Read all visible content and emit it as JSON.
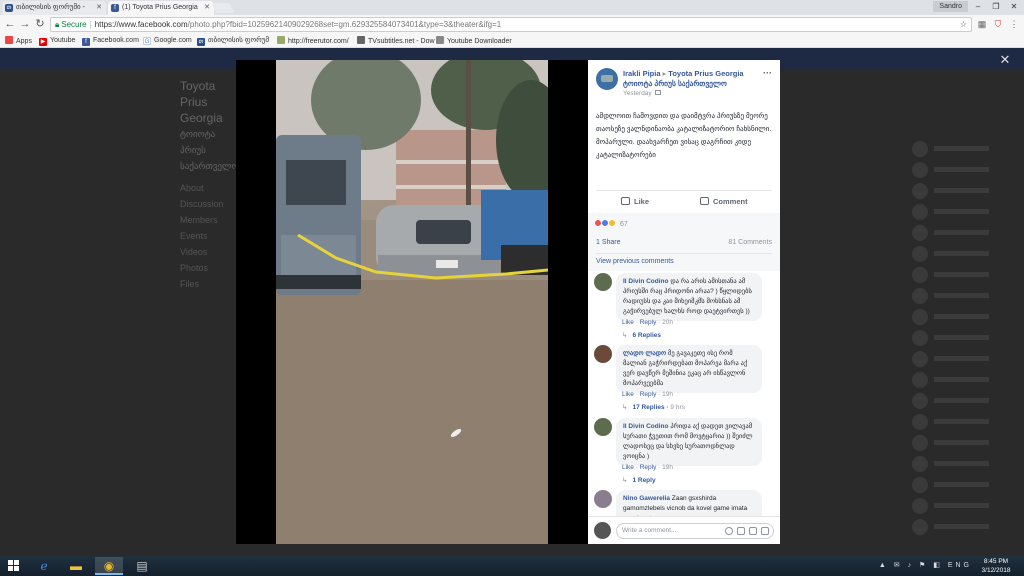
{
  "browser": {
    "tabs": [
      {
        "title": "თბილისის ფორუმი - ",
        "favicon": "forum-favicon",
        "active": false
      },
      {
        "title": "(1) Toyota Prius Georgia",
        "favicon": "facebook-favicon",
        "active": true
      }
    ],
    "user": "Sandro",
    "secure_label": "Secure",
    "url_main": "https://www.facebook.com",
    "url_rest": "/photo.php?fbid=10259621409029268set=gm.629325584073401&type=3&theater&ifg=1",
    "bookmarks": [
      {
        "label": "Apps",
        "icon": "apps-icon",
        "color": "#e44"
      },
      {
        "label": "Youtube",
        "icon": "youtube-icon",
        "color": "#e00"
      },
      {
        "label": "Facebook.com",
        "icon": "facebook-icon",
        "color": "#3b5998"
      },
      {
        "label": "Google.com",
        "icon": "google-icon",
        "color": "#4285f4"
      },
      {
        "label": "თბილისის ფორუმ",
        "icon": "forum-icon",
        "color": "#2b4f8a"
      },
      {
        "label": "http://freerutor.com/",
        "icon": "torrent-icon",
        "color": "#9a6"
      },
      {
        "label": "TVsubtitles.net - Dow",
        "icon": "tv-icon",
        "color": "#666"
      },
      {
        "label": "Youtube Downloader",
        "icon": "downloader-icon",
        "color": "#888"
      }
    ]
  },
  "background": {
    "title": "Toyota Prius Georgia",
    "subtitle": "ტოიოტა პრიუს საქართველო",
    "menu": [
      "About",
      "Discussion",
      "Members",
      "Events",
      "Videos",
      "Photos",
      "Files"
    ]
  },
  "post": {
    "author": "Irakli Pipia",
    "group": "Toyota Prius Georgia",
    "group_ka": "ტოიოტა პრიუს საქართველო",
    "time": "Yesterday",
    "text": "ამდლოით ჩამოვდით და დაიმტვრა პრიუსზე მეორე თაოსეზე ვალნდინაობა კატალიზატორიო ჩახსნილი. მოპარული. დაახვარჩეთ ვისაც დაგრჩით კიდე კატალიზატორები",
    "like_label": "Like",
    "comment_label": "Comment",
    "reaction_count": "67",
    "share_label": "1 Share",
    "comments_count": "81 Comments",
    "view_previous": "View previous comments"
  },
  "comments": [
    {
      "name": "Il Divin Codino",
      "text": "და რა არის ამისთანა ამ პრიუსში რაც პრიდონი არაა? ) წყლიდებს რადიუსს და კაი მიხეიმკმს მოხსნას ამ გაჭირვებულ ხალხს როდ დაეტვირთეს ))",
      "like": "Like",
      "reply": "Reply",
      "time": "20h",
      "replies": "6 Replies",
      "reply_time": ""
    },
    {
      "name": "ლადო ლადო",
      "text": "მე გავაკეთე ისე რომ მალიან გაჭრირდებათ მოპარვა მარა აქ ვერ დავწერ მეშინია ეკაც არ ისწავლონ მოპარვეებმა",
      "like": "Like",
      "reply": "Reply",
      "time": "19h",
      "replies": "17 Replies",
      "reply_time": "9 hrs"
    },
    {
      "name": "Il Divin Codino",
      "text": "პრიდა აქ დადეთ ვილავამ სურათი ჭვეთით რომ მოვტყარია )) შეიძლ ლადოსეც და სხვხე სურათოდნლად ვოიცნა )",
      "like": "Like",
      "reply": "Reply",
      "time": "19h",
      "replies": "1 Reply",
      "reply_time": ""
    },
    {
      "name": "Nino Gawerelia",
      "text": "Zaan gsxshirda gamomzlebels vicnob da kovel game imata am shemtxvevamo",
      "like": "",
      "reply": "",
      "time": "",
      "replies": "",
      "reply_time": ""
    }
  ],
  "write_placeholder": "Write a comment...",
  "taskbar": {
    "tray": "▲ ✉ ♪ ⚑ ◧ ENG",
    "time": "8:45 PM",
    "date": "3/12/2018"
  }
}
